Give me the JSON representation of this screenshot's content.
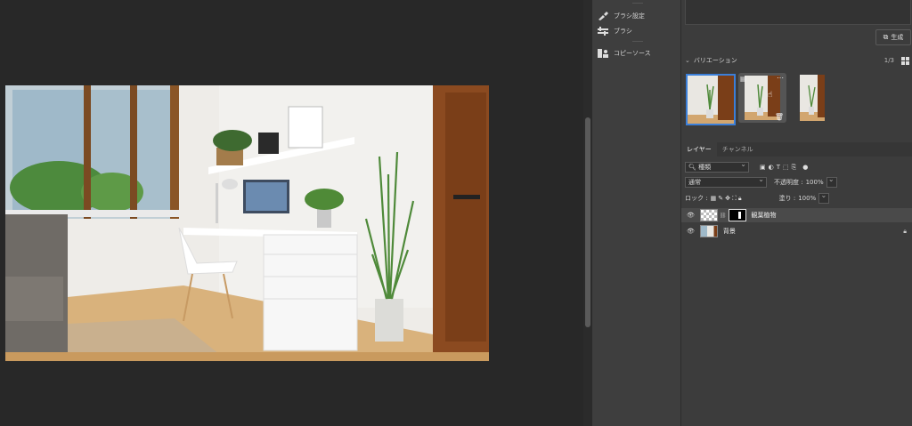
{
  "tools_panel": {
    "brush_settings_label": "ブラシ設定",
    "brush_label": "ブラシ",
    "clone_source_label": "コピーソース"
  },
  "generate": {
    "button_label": "生成"
  },
  "variations": {
    "title": "バリエーション",
    "counter": "1/3"
  },
  "layers_panel": {
    "tabs": [
      "レイヤー",
      "チャンネル"
    ],
    "filter_label": "種類",
    "blend_mode": "通常",
    "opacity_label": "不透明度 :",
    "opacity_value": "100%",
    "lock_label": "ロック :",
    "fill_label": "塗り :",
    "fill_value": "100%",
    "layers": [
      {
        "name": "観葉植物",
        "selected": true
      },
      {
        "name": "背景",
        "selected": false
      }
    ]
  },
  "colors": {
    "accent": "#3b7fd9",
    "panel": "#3c3c3c",
    "canvas": "#282828"
  }
}
